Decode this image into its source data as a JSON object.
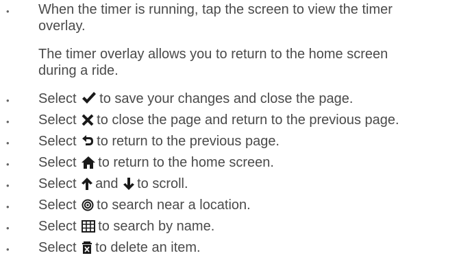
{
  "heading_fragment": "",
  "first_item": {
    "line1": "When the timer is running, tap the screen to view the timer",
    "line2": "overlay.",
    "para_line1": "The timer overlay allows you to return to the home screen",
    "para_line2": "during a ride."
  },
  "items": [
    {
      "pre": "Select",
      "post": "to save your changes and close the page.",
      "icon": "checkmark-icon"
    },
    {
      "pre": "Select",
      "post": "to close the page and return to the previous page.",
      "icon": "close-x-icon"
    },
    {
      "pre": "Select",
      "post": "to return to the previous page.",
      "icon": "back-arrow-icon"
    },
    {
      "pre": "Select",
      "post": "to return to the home screen.",
      "icon": "home-icon"
    },
    {
      "pre": "Select",
      "mid": "and",
      "post": "to scroll.",
      "icon": "up-arrow-icon",
      "icon2": "down-arrow-icon"
    },
    {
      "pre": "Select",
      "post": "to search near a location.",
      "icon": "target-icon"
    },
    {
      "pre": "Select",
      "post": "to search by name.",
      "icon": "keyboard-grid-icon"
    },
    {
      "pre": "Select",
      "post": "to delete an item.",
      "icon": "trash-delete-icon"
    }
  ],
  "bullet_char": "•",
  "colors": {
    "text": "#4a4a4a",
    "icon": "#1a1a1a"
  }
}
